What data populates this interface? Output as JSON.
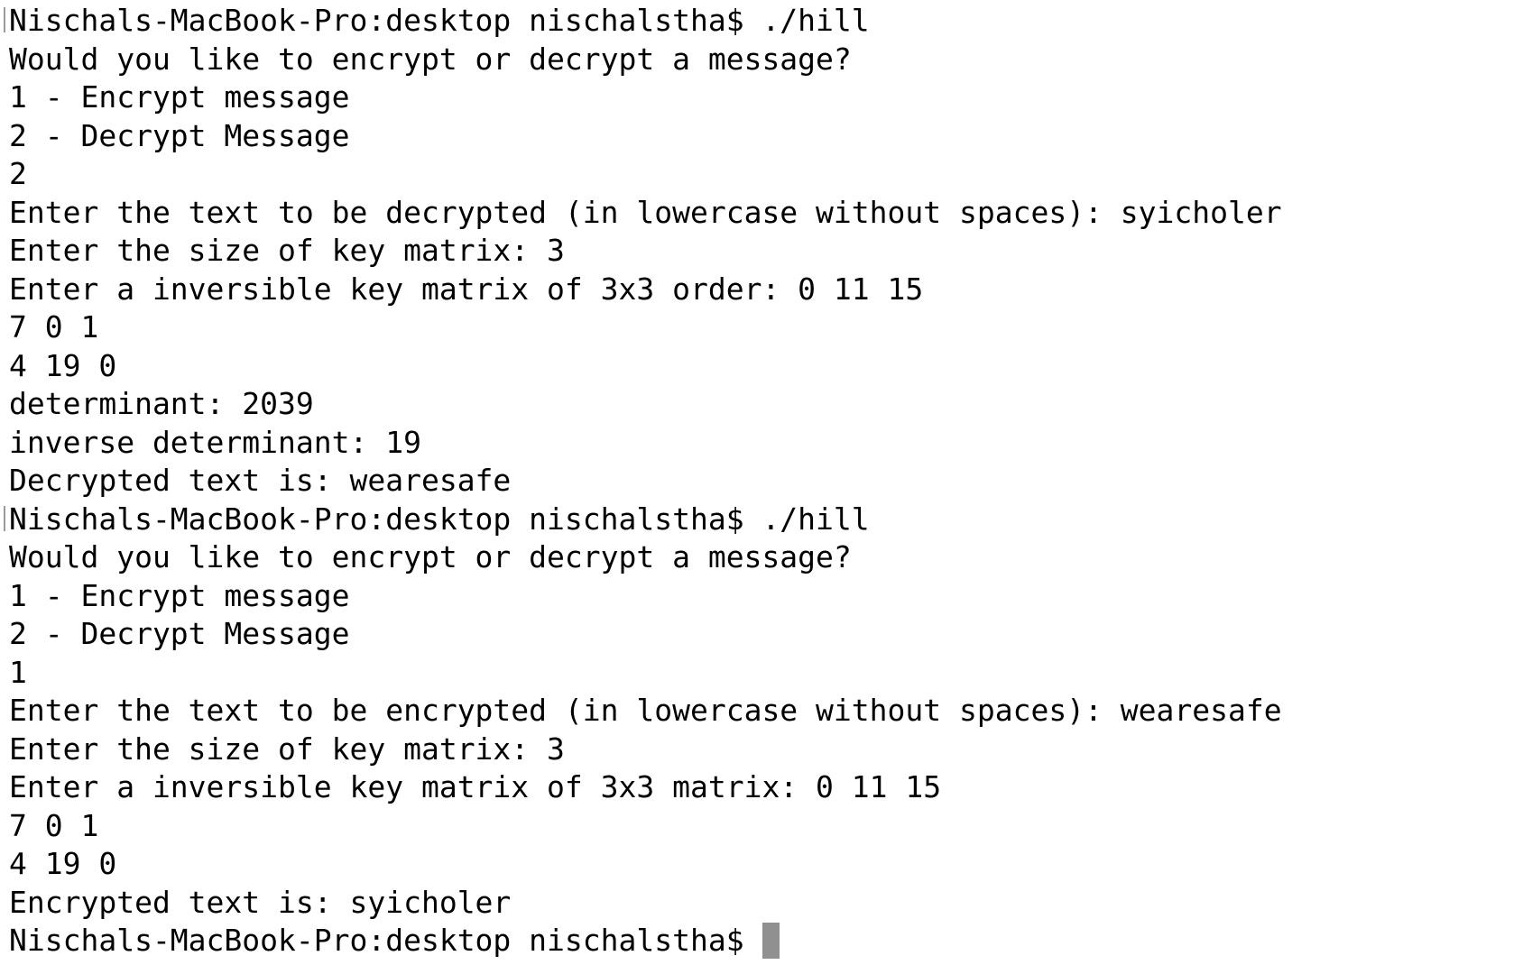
{
  "terminal": {
    "session1": {
      "prompt": "Nischals-MacBook-Pro:desktop nischalstha$ ./hill",
      "question": "Would you like to encrypt or decrypt a message?",
      "option1": "1 - Encrypt message",
      "option2": "2 - Decrypt Message",
      "choice": "2",
      "text_prompt": "Enter the text to be decrypted (in lowercase without spaces): syicholer",
      "size_prompt": "Enter the size of key matrix: 3",
      "matrix_prompt": "Enter a inversible key matrix of 3x3 order: 0 11 15",
      "matrix_row2": "7 0 1",
      "matrix_row3": "4 19 0",
      "determinant": "determinant: 2039",
      "inverse_determinant": "inverse determinant: 19",
      "result": "Decrypted text is: wearesafe"
    },
    "session2": {
      "prompt": "Nischals-MacBook-Pro:desktop nischalstha$ ./hill",
      "question": "Would you like to encrypt or decrypt a message?",
      "option1": "1 - Encrypt message",
      "option2": "2 - Decrypt Message",
      "choice": "1",
      "text_prompt": "Enter the text to be encrypted (in lowercase without spaces): wearesafe",
      "size_prompt": "Enter the size of key matrix: 3",
      "matrix_prompt": "Enter a inversible key matrix of 3x3 matrix: 0 11 15",
      "matrix_row2": "7 0 1",
      "matrix_row3": "4 19 0",
      "result": "Encrypted text is: syicholer"
    },
    "final_prompt": "Nischals-MacBook-Pro:desktop nischalstha$",
    "colors": {
      "background": "#ffffff",
      "text": "#000000",
      "cursor": "#909090"
    }
  }
}
